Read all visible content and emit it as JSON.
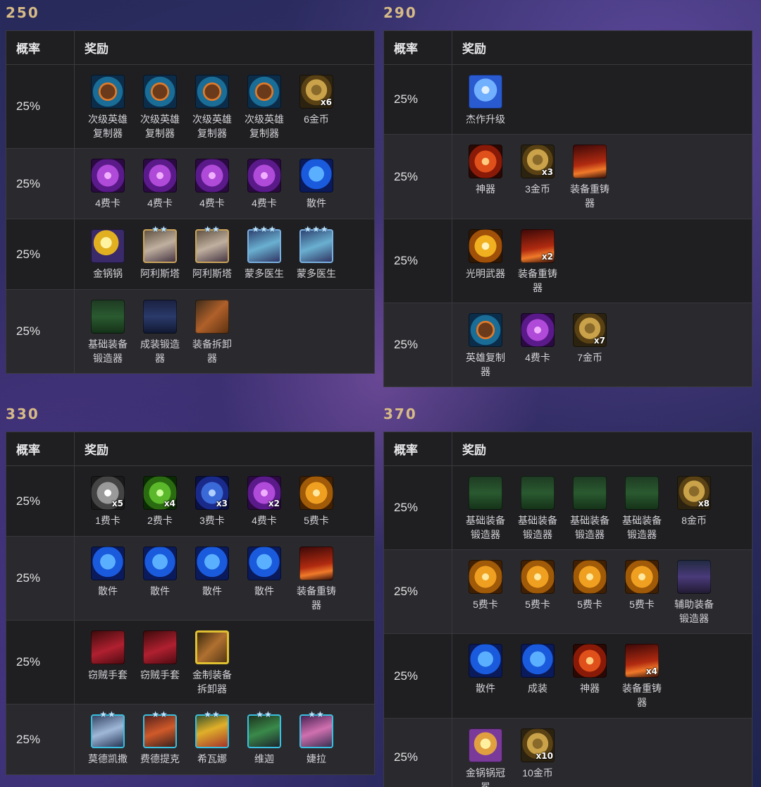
{
  "headers": {
    "rate": "概率",
    "reward": "奖励"
  },
  "sections": [
    {
      "title": "250",
      "rows": [
        {
          "rate": "25%",
          "items": [
            {
              "icon": "champion-duplicator-icon",
              "style": "ic-dup",
              "label": "次级英雄复制器",
              "count": ""
            },
            {
              "icon": "champion-duplicator-icon",
              "style": "ic-dup",
              "label": "次级英雄复制器",
              "count": ""
            },
            {
              "icon": "champion-duplicator-icon",
              "style": "ic-dup",
              "label": "次级英雄复制器",
              "count": ""
            },
            {
              "icon": "champion-duplicator-icon",
              "style": "ic-dup",
              "label": "次级英雄复制器",
              "count": ""
            },
            {
              "icon": "gold-coin-icon",
              "style": "ic-coin",
              "label": "6金币",
              "count": "x6"
            }
          ]
        },
        {
          "rate": "25%",
          "items": [
            {
              "icon": "four-cost-card-icon",
              "style": "ic-c4",
              "label": "4费卡",
              "count": ""
            },
            {
              "icon": "four-cost-card-icon",
              "style": "ic-c4",
              "label": "4费卡",
              "count": ""
            },
            {
              "icon": "four-cost-card-icon",
              "style": "ic-c4",
              "label": "4费卡",
              "count": ""
            },
            {
              "icon": "four-cost-card-icon",
              "style": "ic-c4",
              "label": "4费卡",
              "count": ""
            },
            {
              "icon": "component-question-icon",
              "style": "ic-comp",
              "label": "散件",
              "count": ""
            }
          ]
        },
        {
          "rate": "25%",
          "items": [
            {
              "icon": "golden-pan-icon",
              "style": "ic-goldpan",
              "label": "金锅锅",
              "count": ""
            },
            {
              "icon": "champion-alistar-icon",
              "style": "ic-champ1",
              "label": "阿利斯塔",
              "count": "",
              "stars": "★★"
            },
            {
              "icon": "champion-alistar-icon",
              "style": "ic-champ1",
              "label": "阿利斯塔",
              "count": "",
              "stars": "★★"
            },
            {
              "icon": "champion-mundo-icon",
              "style": "ic-champ2",
              "label": "蒙多医生",
              "count": "",
              "stars": "★★★"
            },
            {
              "icon": "champion-mundo-icon",
              "style": "ic-champ2",
              "label": "蒙多医生",
              "count": "",
              "stars": "★★★"
            }
          ]
        },
        {
          "rate": "25%",
          "items": [
            {
              "icon": "basic-anvil-icon",
              "style": "ic-anvil",
              "label": "基础装备锻造器",
              "count": ""
            },
            {
              "icon": "completed-anvil-icon",
              "style": "ic-anvil2",
              "label": "成装锻造器",
              "count": ""
            },
            {
              "icon": "item-remover-icon",
              "style": "ic-remover",
              "label": "装备拆卸器",
              "count": ""
            }
          ]
        }
      ]
    },
    {
      "title": "290",
      "rows": [
        {
          "rate": "25%",
          "items": [
            {
              "icon": "masterwork-upgrade-icon",
              "style": "ic-masterwork",
              "label": "杰作升级",
              "count": ""
            }
          ]
        },
        {
          "rate": "25%",
          "items": [
            {
              "icon": "artifact-icon",
              "style": "ic-artifact",
              "label": "神器",
              "count": ""
            },
            {
              "icon": "gold-coin-icon",
              "style": "ic-coin",
              "label": "3金币",
              "count": "x3"
            },
            {
              "icon": "reforger-icon",
              "style": "ic-reforge",
              "label": "装备重铸器",
              "count": ""
            }
          ]
        },
        {
          "rate": "25%",
          "items": [
            {
              "icon": "radiant-weapon-icon",
              "style": "ic-radiant",
              "label": "光明武器",
              "count": ""
            },
            {
              "icon": "reforger-icon",
              "style": "ic-reforge",
              "label": "装备重铸器",
              "count": "x2"
            }
          ]
        },
        {
          "rate": "25%",
          "items": [
            {
              "icon": "champion-duplicator-icon",
              "style": "ic-dup",
              "label": "英雄复制器",
              "count": ""
            },
            {
              "icon": "four-cost-card-icon",
              "style": "ic-c4",
              "label": "4费卡",
              "count": ""
            },
            {
              "icon": "gold-coin-icon",
              "style": "ic-coin",
              "label": "7金币",
              "count": "x7"
            }
          ]
        }
      ]
    },
    {
      "title": "330",
      "rows": [
        {
          "rate": "25%",
          "items": [
            {
              "icon": "one-cost-card-icon",
              "style": "ic-c1",
              "label": "1费卡",
              "count": "x5"
            },
            {
              "icon": "two-cost-card-icon",
              "style": "ic-c2",
              "label": "2费卡",
              "count": "x4"
            },
            {
              "icon": "three-cost-card-icon",
              "style": "ic-c3",
              "label": "3费卡",
              "count": "x3"
            },
            {
              "icon": "four-cost-card-icon",
              "style": "ic-c4",
              "label": "4费卡",
              "count": "x2"
            },
            {
              "icon": "five-cost-card-icon",
              "style": "ic-c5",
              "label": "5费卡",
              "count": ""
            }
          ]
        },
        {
          "rate": "25%",
          "items": [
            {
              "icon": "component-question-icon",
              "style": "ic-comp",
              "label": "散件",
              "count": ""
            },
            {
              "icon": "component-question-icon",
              "style": "ic-comp",
              "label": "散件",
              "count": ""
            },
            {
              "icon": "component-question-icon",
              "style": "ic-comp",
              "label": "散件",
              "count": ""
            },
            {
              "icon": "component-question-icon",
              "style": "ic-comp",
              "label": "散件",
              "count": ""
            },
            {
              "icon": "reforger-icon",
              "style": "ic-reforge",
              "label": "装备重铸器",
              "count": ""
            }
          ]
        },
        {
          "rate": "25%",
          "items": [
            {
              "icon": "thiefs-gloves-icon",
              "style": "ic-thief",
              "label": "窃贼手套",
              "count": ""
            },
            {
              "icon": "thiefs-gloves-icon",
              "style": "ic-thief",
              "label": "窃贼手套",
              "count": ""
            },
            {
              "icon": "golden-item-remover-icon",
              "style": "ic-remover-gold",
              "label": "金制装备拆卸器",
              "count": ""
            }
          ]
        },
        {
          "rate": "25%",
          "items": [
            {
              "icon": "champion-mordekaiser-icon",
              "style": "ic-champ3",
              "label": "莫德凯撒",
              "count": "",
              "stars": "★★"
            },
            {
              "icon": "champion-fiddlesticks-icon",
              "style": "ic-champ4",
              "label": "费德提克",
              "count": "",
              "stars": "★★"
            },
            {
              "icon": "champion-shyvana-icon",
              "style": "ic-champ5",
              "label": "希瓦娜",
              "count": "",
              "stars": "★★"
            },
            {
              "icon": "champion-veigar-icon",
              "style": "ic-champ6",
              "label": "维迦",
              "count": "",
              "stars": "★★"
            },
            {
              "icon": "champion-zyra-icon",
              "style": "ic-champ7",
              "label": "婕拉",
              "count": "",
              "stars": "★★"
            }
          ]
        }
      ]
    },
    {
      "title": "370",
      "rows": [
        {
          "rate": "25%",
          "items": [
            {
              "icon": "basic-anvil-icon",
              "style": "ic-anvil",
              "label": "基础装备锻造器",
              "count": ""
            },
            {
              "icon": "basic-anvil-icon",
              "style": "ic-anvil",
              "label": "基础装备锻造器",
              "count": ""
            },
            {
              "icon": "basic-anvil-icon",
              "style": "ic-anvil",
              "label": "基础装备锻造器",
              "count": ""
            },
            {
              "icon": "basic-anvil-icon",
              "style": "ic-anvil",
              "label": "基础装备锻造器",
              "count": ""
            },
            {
              "icon": "gold-coin-icon",
              "style": "ic-coin",
              "label": "8金币",
              "count": "x8"
            }
          ]
        },
        {
          "rate": "25%",
          "items": [
            {
              "icon": "five-cost-card-icon",
              "style": "ic-c5",
              "label": "5费卡",
              "count": ""
            },
            {
              "icon": "five-cost-card-icon",
              "style": "ic-c5",
              "label": "5费卡",
              "count": ""
            },
            {
              "icon": "five-cost-card-icon",
              "style": "ic-c5",
              "label": "5费卡",
              "count": ""
            },
            {
              "icon": "five-cost-card-icon",
              "style": "ic-c5",
              "label": "5费卡",
              "count": ""
            },
            {
              "icon": "support-anvil-icon",
              "style": "ic-anvil3",
              "label": "辅助装备锻造器",
              "count": ""
            }
          ]
        },
        {
          "rate": "25%",
          "items": [
            {
              "icon": "component-question-icon",
              "style": "ic-comp",
              "label": "散件",
              "count": ""
            },
            {
              "icon": "completed-item-icon",
              "style": "ic-comp",
              "label": "成装",
              "count": ""
            },
            {
              "icon": "artifact-icon",
              "style": "ic-artifact",
              "label": "神器",
              "count": ""
            },
            {
              "icon": "reforger-icon",
              "style": "ic-reforge",
              "label": "装备重铸器",
              "count": "x4"
            }
          ]
        },
        {
          "rate": "25%",
          "items": [
            {
              "icon": "golden-pan-crown-icon",
              "style": "ic-crown",
              "label": "金锅锅冠冕",
              "count": ""
            },
            {
              "icon": "gold-coin-icon",
              "style": "ic-coin",
              "label": "10金币",
              "count": "x10"
            }
          ]
        }
      ]
    }
  ]
}
